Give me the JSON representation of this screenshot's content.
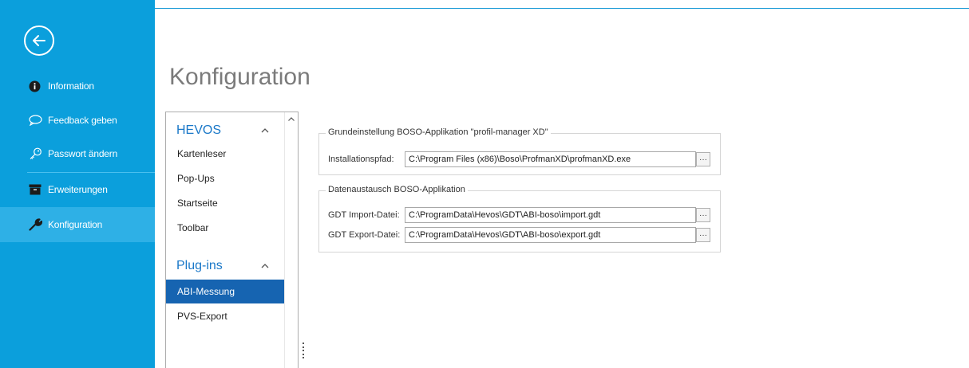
{
  "sidebar": {
    "items": [
      {
        "label": "Information",
        "icon": "info-icon"
      },
      {
        "label": "Feedback geben",
        "icon": "speech-bubble-icon"
      },
      {
        "label": "Passwort ändern",
        "icon": "key-icon"
      },
      {
        "label": "Erweiterungen",
        "icon": "archive-box-icon"
      },
      {
        "label": "Konfiguration",
        "icon": "wrench-icon",
        "active": true
      }
    ]
  },
  "page": {
    "title": "Konfiguration"
  },
  "categories": {
    "groups": [
      {
        "title": "HEVOS",
        "items": [
          "Kartenleser",
          "Pop-Ups",
          "Startseite",
          "Toolbar"
        ]
      },
      {
        "title": "Plug-ins",
        "items": [
          "ABI-Messung",
          "PVS-Export"
        ]
      }
    ],
    "selected": "ABI-Messung"
  },
  "settings": {
    "grundeinstellung": {
      "legend": "Grundeinstellung BOSO-Applikation \"profil-manager XD\"",
      "install_label": "Installationspfad:",
      "install_value": "C:\\Program Files (x86)\\Boso\\ProfmanXD\\profmanXD.exe"
    },
    "datenaustausch": {
      "legend": "Datenaustausch BOSO-Applikation",
      "import_label": "GDT Import-Datei:",
      "import_value": "C:\\ProgramData\\Hevos\\GDT\\ABI-boso\\import.gdt",
      "export_label": "GDT Export-Datei:",
      "export_value": "C:\\ProgramData\\Hevos\\GDT\\ABI-boso\\export.gdt"
    },
    "browse_label": "···"
  },
  "colors": {
    "sidebar": "#0b9fdc",
    "sidebar_active": "#2eb0e6",
    "selected_item": "#1664b1",
    "group_title": "#1a78c8"
  }
}
